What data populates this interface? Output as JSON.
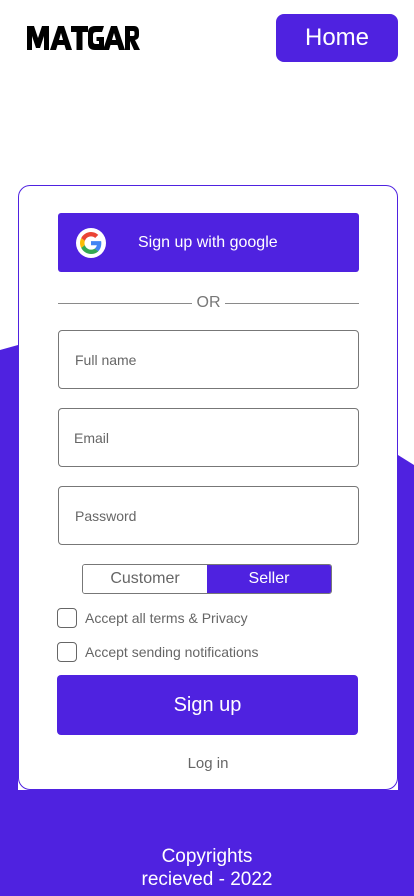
{
  "header": {
    "logo_text": "MATGAR",
    "home_label": "Home"
  },
  "signup_card": {
    "google_label": "Sign up with google",
    "divider_label": "OR",
    "fields": {
      "full_name_placeholder": "Full name",
      "email_placeholder": "Email",
      "password_placeholder": "Password"
    },
    "role_toggle": {
      "options": [
        "Customer",
        "Seller"
      ],
      "selected": "Seller"
    },
    "checkboxes": {
      "terms_label": "Accept all terms & Privacy",
      "notifications_label": "Accept sending notifications"
    },
    "signup_label": "Sign up",
    "login_label": "Log in"
  },
  "footer": {
    "line1": "Copyrights",
    "line2": "recieved - 2022"
  },
  "colors": {
    "accent": "#4F22E0",
    "background": "#FFFFFF"
  }
}
